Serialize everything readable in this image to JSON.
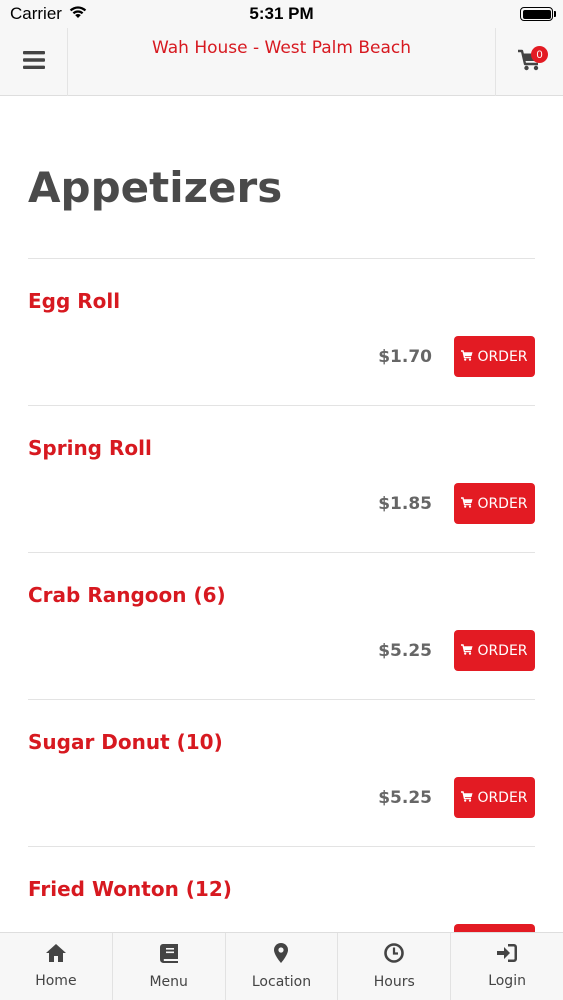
{
  "status_bar": {
    "carrier": "Carrier",
    "time": "5:31 PM"
  },
  "header": {
    "title": "Wah House - West Palm Beach",
    "cart_count": "0"
  },
  "section": {
    "title": "Appetizers"
  },
  "order_label": "ORDER",
  "items": [
    {
      "name": "Egg Roll",
      "price": "$1.70"
    },
    {
      "name": "Spring Roll",
      "price": "$1.85"
    },
    {
      "name": "Crab Rangoon (6)",
      "price": "$5.25"
    },
    {
      "name": "Sugar Donut (10)",
      "price": "$5.25"
    },
    {
      "name": "Fried Wonton (12)",
      "price": ""
    }
  ],
  "tabs": [
    {
      "label": "Home",
      "icon": "home-icon"
    },
    {
      "label": "Menu",
      "icon": "book-icon"
    },
    {
      "label": "Location",
      "icon": "map-pin-icon"
    },
    {
      "label": "Hours",
      "icon": "clock-icon"
    },
    {
      "label": "Login",
      "icon": "sign-in-icon"
    }
  ],
  "colors": {
    "accent": "#e31b23",
    "title_red": "#d71920",
    "bar_bg": "#f7f7f7"
  }
}
